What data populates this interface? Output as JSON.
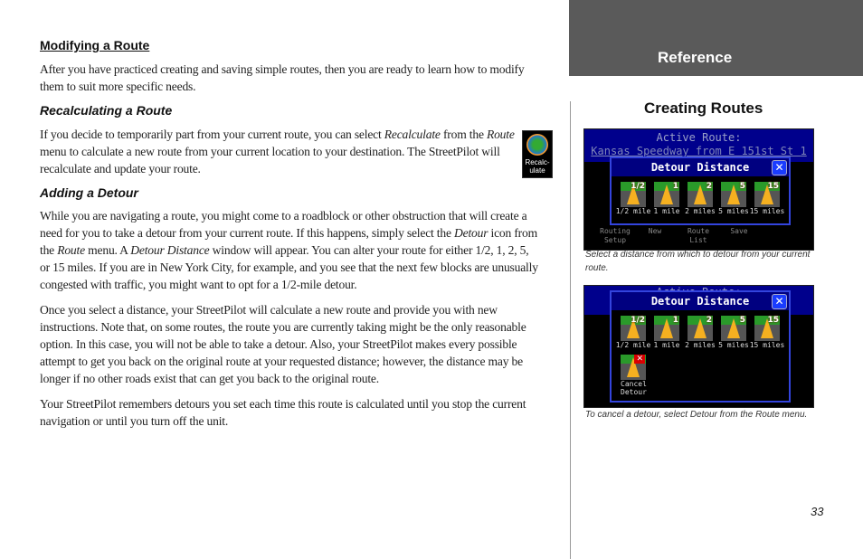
{
  "heading": "Modifying a Route",
  "intro": [
    [
      {
        "t": "After you have practiced creating and saving simple routes, then you are ready to learn how to modify"
      }
    ],
    [
      {
        "t": "them to suit more specific needs."
      }
    ]
  ],
  "sub1": "Recalculating a Route",
  "recalc_para": [
    [
      {
        "t": "If you decide to temporarily part from your current route, you can select "
      },
      {
        "t": "Recalculate",
        "i": 1
      },
      {
        "t": " from the "
      },
      {
        "t": "Route",
        "i": 1
      }
    ],
    [
      {
        "t": "menu to calculate a new route from your current location to your destination. The StreetPilot will"
      }
    ],
    [
      {
        "t": "recalculate and update your route."
      }
    ]
  ],
  "recalc_icon": {
    "label1": "Recalc-",
    "label2": "ulate"
  },
  "sub2": "Adding a Detour",
  "detour_paras": [
    [
      [
        {
          "t": "While you are navigating a route, you might come to a roadblock or other obstruction that will create a"
        }
      ],
      [
        {
          "t": "need for you to take a detour from your current route. If this happens, simply select the "
        },
        {
          "t": "Detour",
          "i": 1
        },
        {
          "t": " icon from"
        }
      ],
      [
        {
          "t": "the "
        },
        {
          "t": "Route",
          "i": 1
        },
        {
          "t": " menu. A "
        },
        {
          "t": "Detour Distance",
          "i": 1
        },
        {
          "t": " window will appear. You can alter your route for either 1/2, 1, 2, 5,"
        }
      ],
      [
        {
          "t": "or 15 miles. If you are in New York City, for example, and you see that the next few blocks are unusually"
        }
      ],
      [
        {
          "t": "congested with traffic, you might want to opt for a 1/2-mile detour."
        }
      ]
    ],
    [
      [
        {
          "t": "Once you select a distance, your StreetPilot will calculate a new route and provide you with new"
        }
      ],
      [
        {
          "t": "instructions. Note that, on some routes, the route you are currently taking might be the only reasonable"
        }
      ],
      [
        {
          "t": "option. In this case, you will not be able to take a detour. Also, your StreetPilot makes every possible"
        }
      ],
      [
        {
          "t": "attempt to get you back on the original route at your requested distance; however, the distance may be"
        }
      ],
      [
        {
          "t": "longer if no other roads exist that can get you back to the original route."
        }
      ]
    ],
    [
      [
        {
          "t": "Your StreetPilot remembers detours you set each time this route is calculated until you stop the current"
        }
      ],
      [
        {
          "t": "navigation or until you turn off the unit."
        }
      ]
    ]
  ],
  "sidebar": {
    "section": "Reference",
    "title": "Creating Routes"
  },
  "shot1": {
    "band_line1": "Active Route:",
    "band_line2": "Kansas Speedway from E 151st St 1",
    "dialog_title": "Detour Distance",
    "options": [
      {
        "num": "1/2",
        "label": "1/2 mile"
      },
      {
        "num": "1",
        "label": "1 mile"
      },
      {
        "num": "2",
        "label": "2 miles"
      },
      {
        "num": "5",
        "label": "5 miles"
      },
      {
        "num": "15",
        "label": "15 miles"
      }
    ],
    "menu": [
      "Routing Setup",
      "New",
      "Route List",
      "Save"
    ],
    "caption": "Select a distance from which to detour from your current route."
  },
  "shot2": {
    "band_line1": "Active Route:",
    "dialog_title": "Detour Distance",
    "options": [
      {
        "num": "1/2",
        "label": "1/2 mile"
      },
      {
        "num": "1",
        "label": "1 mile"
      },
      {
        "num": "2",
        "label": "2 miles"
      },
      {
        "num": "5",
        "label": "5 miles"
      },
      {
        "num": "15",
        "label": "15 miles"
      }
    ],
    "cancel": "Cancel Detour",
    "caption": "To cancel a detour, select Detour from the Route menu."
  },
  "page_number": "33"
}
